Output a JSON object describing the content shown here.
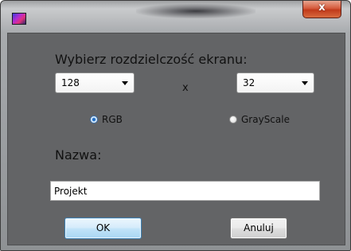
{
  "titlebar": {
    "close_glyph": "x"
  },
  "dialog": {
    "heading": "Wybierz rozdzielczość ekranu:",
    "width_select": {
      "value": "128"
    },
    "separator": "x",
    "height_select": {
      "value": "32"
    },
    "color_modes": [
      {
        "label": "RGB",
        "checked": true
      },
      {
        "label": "GrayScale",
        "checked": false
      }
    ],
    "name_label": "Nazwa:",
    "name_input": {
      "value": "Projekt"
    },
    "ok_label": "OK",
    "cancel_label": "Anuluj"
  },
  "colors": {
    "client_background": "#636466",
    "close_button": "#c84b2c",
    "ok_border": "#3c7fb1"
  },
  "icons": {
    "app_icon": "app-icon",
    "close": "close-icon"
  }
}
